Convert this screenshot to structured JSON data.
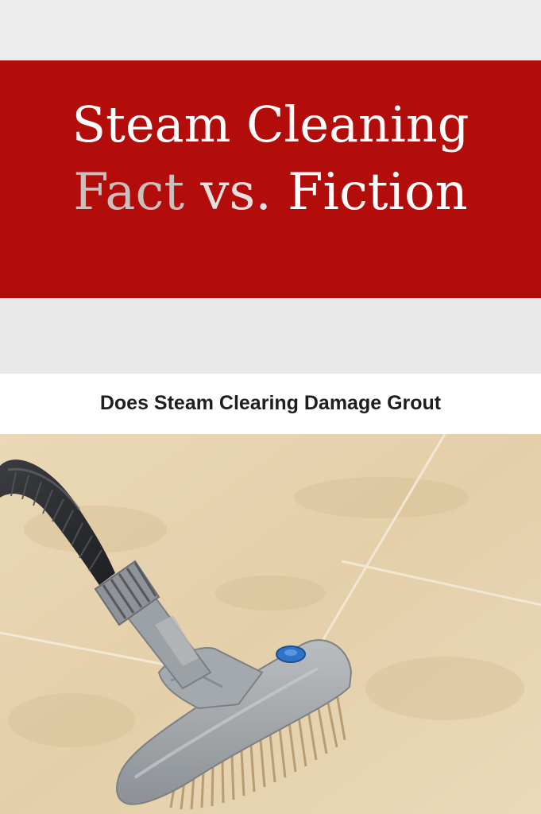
{
  "title": {
    "line1": "Steam Cleaning",
    "line2_fact": "Fact",
    "line2_vs": "vs.",
    "line2_fiction": "Fiction"
  },
  "subtitle": "Does Steam Clearing Damage Grout",
  "colors": {
    "banner": "#b20d0a",
    "title_text": "#ffffff",
    "subtitle_text": "#1e1e1e",
    "tile": "#e6d3b1",
    "brush_body": "#9ea3a6",
    "hose": "#2b2d30"
  },
  "image": {
    "icon": "steam-cleaner-brush-on-tile-floor"
  }
}
